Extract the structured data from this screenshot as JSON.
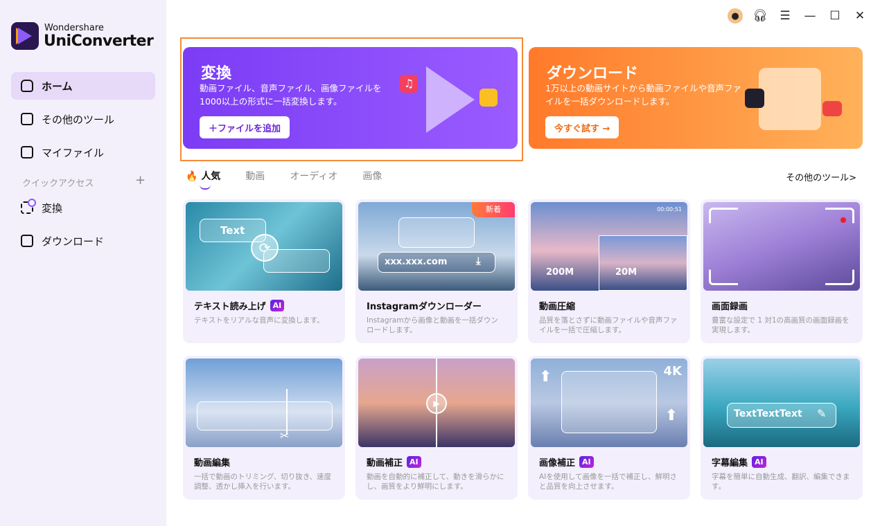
{
  "app": {
    "brand_top": "Wondershare",
    "brand_name": "UniConverter"
  },
  "sidebar": {
    "items": [
      {
        "label": "ホーム",
        "icon": "home-icon"
      },
      {
        "label": "その他のツール",
        "icon": "toolbox-icon"
      },
      {
        "label": "マイファイル",
        "icon": "file-icon"
      }
    ],
    "quick_access_label": "クイックアクセス",
    "quick_access_add": "+",
    "quick_items": [
      {
        "label": "変換",
        "icon": "convert-icon"
      },
      {
        "label": "ダウンロード",
        "icon": "download-icon"
      }
    ]
  },
  "topbar": {
    "icons": [
      "avatar",
      "headset-icon",
      "menu-icon",
      "minimize-icon",
      "maximize-icon",
      "close-icon"
    ]
  },
  "banners": [
    {
      "title": "変換",
      "desc": "動画ファイル、音声ファイル、画像ファイルを1000以上の形式に一括変換します。",
      "button": "＋ファイルを追加",
      "color": "#7b3cf5"
    },
    {
      "title": "ダウンロード",
      "desc": "1万以上の動画サイトから動画ファイルや音声ファイルを一括ダウンロードします。",
      "button": "今すぐ試す →",
      "color": "#ff7a2a"
    }
  ],
  "tabs": [
    {
      "label": "人気",
      "active": true
    },
    {
      "label": "動画"
    },
    {
      "label": "オーディオ"
    },
    {
      "label": "画像"
    }
  ],
  "more_tools": "その他のツール>",
  "cards": [
    {
      "title": "テキスト読み上げ",
      "ai": true,
      "desc": "テキストをリアルな音声に変換します。",
      "overlay": "Text"
    },
    {
      "title": "Instagramダウンローダー",
      "ai": false,
      "desc": "Instagramから画像と動画を一括ダウンロードします。",
      "overlay": "xxx.xxx.com",
      "badge": "新着"
    },
    {
      "title": "動画圧縮",
      "ai": false,
      "desc": "品質を落とさずに動画ファイルや音声ファイルを一括で圧縮します。",
      "overlay": "200M",
      "overlay2": "20M",
      "timestamp": "00:00:51"
    },
    {
      "title": "画面録画",
      "ai": false,
      "desc": "豊富な設定で 1 対1の高画質の画面録画を実現します。"
    },
    {
      "title": "動画編集",
      "ai": false,
      "desc": "一括で動画のトリミング、切り抜き、速度調整、透かし挿入を行います。"
    },
    {
      "title": "動画補正",
      "ai": true,
      "desc": "動画を自動的に補正して、動きを滑らかにし、画質をより鮮明にします。"
    },
    {
      "title": "画像補正",
      "ai": true,
      "desc": "AIを使用して画像を一括で補正し、鮮明さと品質を向上させます。",
      "overlay": "4K"
    },
    {
      "title": "字幕編集",
      "ai": true,
      "desc": "字幕を簡単に自動生成、翻訳、編集できます。",
      "overlay": "TextTextText"
    }
  ],
  "ai_label": "AI"
}
